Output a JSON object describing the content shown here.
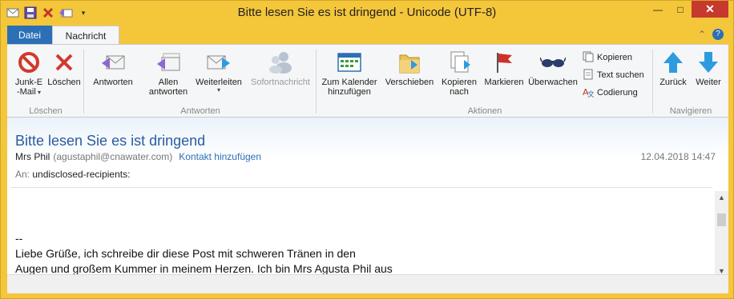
{
  "window": {
    "title": "Bitte lesen Sie es ist dringend - Unicode (UTF-8)",
    "buttons": {
      "minimize": "—",
      "maximize": "□",
      "close": "✕"
    }
  },
  "quick_access": {
    "icons": [
      "mail-icon",
      "save-icon",
      "delete-icon",
      "reply-icon",
      "dropdown-icon"
    ]
  },
  "tabs": {
    "file": "Datei",
    "active": "Nachricht"
  },
  "ribbon": {
    "loeschen": {
      "label": "Löschen",
      "junk_line1": "Junk-E",
      "junk_line2": "-Mail",
      "delete": "Löschen"
    },
    "antworten": {
      "label": "Antworten",
      "reply": "Antworten",
      "reply_all_line1": "Allen",
      "reply_all_line2": "antworten",
      "forward": "Weiterleiten",
      "im": "Sofortnachricht"
    },
    "aktionen": {
      "label": "Aktionen",
      "calendar_line1": "Zum Kalender",
      "calendar_line2": "hinzufügen",
      "move": "Verschieben",
      "copy_line1": "Kopieren",
      "copy_line2": "nach",
      "flag": "Markieren",
      "watch": "Überwachen",
      "small_copy": "Kopieren",
      "find": "Text suchen",
      "encoding": "Codierung"
    },
    "navigieren": {
      "label": "Navigieren",
      "back": "Zurück",
      "next": "Weiter"
    }
  },
  "message": {
    "subject": "Bitte lesen Sie es ist dringend",
    "sender_name": "Mrs Phil",
    "sender_address": "(agustaphil@cnawater.com)",
    "add_contact": "Kontakt hinzufügen",
    "date": "12.04.2018 14:47",
    "to_label": "An:",
    "to_value": "undisclosed-recipients:",
    "body_lines": [
      "--",
      "Liebe Grüße, ich schreibe dir diese Post mit schweren Tränen in den",
      "Augen und großem Kummer in meinem Herzen. Ich bin Mrs Agusta Phil aus"
    ]
  },
  "colors": {
    "titlebar": "#f4c63a",
    "file_tab": "#2b6fb6",
    "subject": "#2b5c9e",
    "close_button": "#c7382d"
  }
}
